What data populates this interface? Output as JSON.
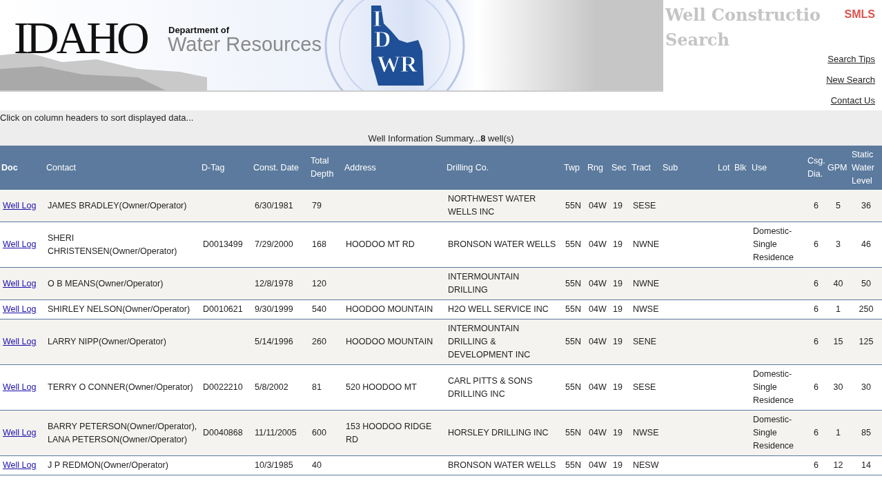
{
  "banner": {
    "state_name": "IDAHO",
    "dept_line": "Department of",
    "dept_name": "Water Resources",
    "logo_letters": [
      "I",
      "D",
      "WR"
    ]
  },
  "title": "Well Constructio Search",
  "badge": "SMLS",
  "links": [
    "Search Tips",
    "New Search",
    "Contact Us"
  ],
  "hint": "Click on column headers to sort displayed data...",
  "summary": "Well Information Summary...**8** well(s)",
  "table": {
    "columns": [
      "Doc",
      "Contact",
      "D-Tag",
      "Const. Date",
      "Total Depth",
      "Address",
      "Drilling Co.",
      "Twp",
      "Rng",
      "Sec",
      "Tract",
      "Sub",
      "Lot",
      "Blk",
      "Use",
      "Csg. Dia.",
      "GPM",
      "Static Water Level"
    ],
    "rows": [
      {
        "cells": [
          "Well Log",
          "JAMES BRADLEY(Owner/Operator)",
          "",
          "6/30/1981",
          "79",
          "",
          "NORTHWEST WATER WELLS INC",
          "55N",
          "04W",
          "19",
          "SESE",
          "",
          "",
          "",
          "",
          "6",
          "5",
          "36"
        ]
      },
      {
        "cells": [
          "Well Log",
          "SHERI CHRISTENSEN(Owner/Operator)",
          "D0013499",
          "7/29/2000",
          "168",
          "HOODOO MT RD",
          "BRONSON WATER WELLS",
          "55N",
          "04W",
          "19",
          "NWNE",
          "",
          "",
          "",
          "Domestic-Single Residence",
          "6",
          "3",
          "46"
        ]
      },
      {
        "cells": [
          "Well Log",
          "O B MEANS(Owner/Operator)",
          "",
          "12/8/1978",
          "120",
          "",
          "INTERMOUNTAIN DRILLING",
          "55N",
          "04W",
          "19",
          "NWNE",
          "",
          "",
          "",
          "",
          "6",
          "40",
          "50"
        ]
      },
      {
        "cells": [
          "Well Log",
          "SHIRLEY NELSON(Owner/Operator)",
          "D0010621",
          "9/30/1999",
          "540",
          "HOODOO MOUNTAIN",
          "H2O WELL SERVICE INC",
          "55N",
          "04W",
          "19",
          "NWSE",
          "",
          "",
          "",
          "",
          "6",
          "1",
          "250"
        ]
      },
      {
        "cells": [
          "Well Log",
          "LARRY NIPP(Owner/Operator)",
          "",
          "5/14/1996",
          "260",
          "HOODOO MOUNTAIN",
          "INTERMOUNTAIN DRILLING & DEVELOPMENT INC",
          "55N",
          "04W",
          "19",
          "SENE",
          "",
          "",
          "",
          "",
          "6",
          "15",
          "125"
        ]
      },
      {
        "cells": [
          "Well Log",
          "TERRY O CONNER(Owner/Operator)",
          "D0022210",
          "5/8/2002",
          "81",
          "520 HOODOO MT",
          "CARL PITTS & SONS DRILLING INC",
          "55N",
          "04W",
          "19",
          "SESE",
          "",
          "",
          "",
          "Domestic-Single Residence",
          "6",
          "30",
          "30"
        ]
      },
      {
        "cells": [
          "Well Log",
          "BARRY PETERSON(Owner/Operator), LANA PETERSON(Owner/Operator)",
          "D0040868",
          "11/11/2005",
          "600",
          "153 HOODOO RIDGE RD",
          "HORSLEY DRILLING INC",
          "55N",
          "04W",
          "19",
          "NWSE",
          "",
          "",
          "",
          "Domestic-Single Residence",
          "6",
          "1",
          "85"
        ]
      },
      {
        "cells": [
          "Well Log",
          "J P REDMON(Owner/Operator)",
          "",
          "10/3/1985",
          "40",
          "",
          "BRONSON WATER WELLS",
          "55N",
          "04W",
          "19",
          "NESW",
          "",
          "",
          "",
          "",
          "6",
          "12",
          "14"
        ]
      }
    ]
  }
}
